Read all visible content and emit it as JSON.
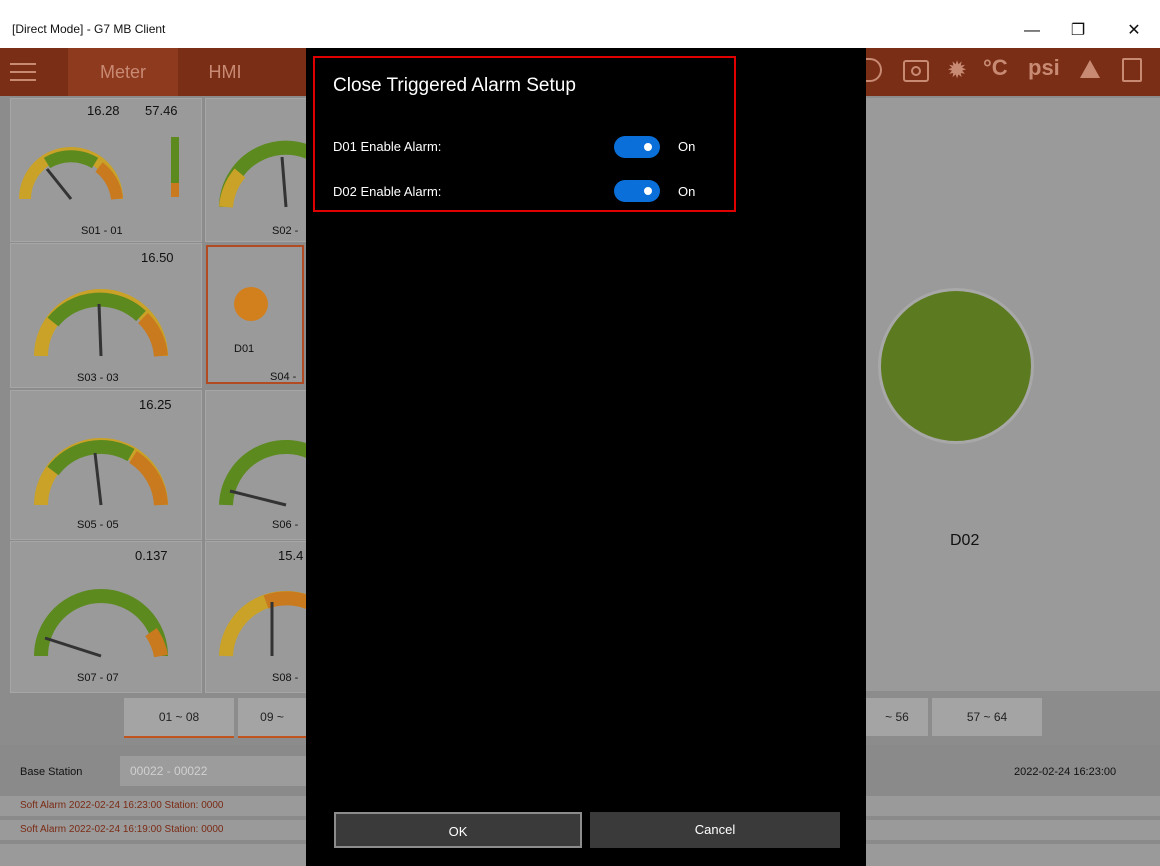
{
  "window": {
    "title": "[Direct Mode] - G7 MB Client",
    "controls": [
      "minimize-icon",
      "restore-icon",
      "close-icon"
    ]
  },
  "toolbar": {
    "tabs": [
      "Meter",
      "HMI"
    ],
    "unit_celsius": "°C",
    "unit_psi": "psi",
    "colors": {
      "bar": "#7a2e16",
      "active_tab": "#8e3a1e"
    }
  },
  "gauges": [
    {
      "value": "16.28",
      "value2": "57.46",
      "label": "S01 - 01"
    },
    {
      "value": "",
      "label": "S02 -"
    },
    {
      "value": "16.50",
      "label": "S03 - 03"
    },
    {
      "value": "",
      "label": "S04 -",
      "indicator": "D01"
    },
    {
      "value": "16.25",
      "label": "S05 - 05"
    },
    {
      "value": "",
      "label": "S06 -"
    },
    {
      "value": "0.137",
      "label": "S07 - 07"
    },
    {
      "value": "15.4",
      "label": "S08 -"
    }
  ],
  "big_indicator": {
    "label": "D02",
    "color": "#5c7a1f"
  },
  "pages": [
    "01 ~ 08",
    "09 ~",
    "~ 56",
    "57 ~ 64"
  ],
  "station": {
    "label": "Base Station",
    "value": "00022 - 00022",
    "timestamp": "2022-02-24 16:23:00"
  },
  "alarms": [
    "Soft Alarm  2022-02-24 16:23:00  Station: 0000",
    "Soft Alarm  2022-02-24 16:19:00  Station: 0000"
  ],
  "dialog": {
    "title": "Close Triggered Alarm Setup",
    "rows": [
      {
        "label": "D01 Enable Alarm:",
        "state": "On",
        "enabled": true
      },
      {
        "label": "D02 Enable Alarm:",
        "state": "On",
        "enabled": true
      }
    ],
    "ok_label": "OK",
    "cancel_label": "Cancel",
    "accent": "#0a6fd8",
    "highlight": "#e00000"
  }
}
